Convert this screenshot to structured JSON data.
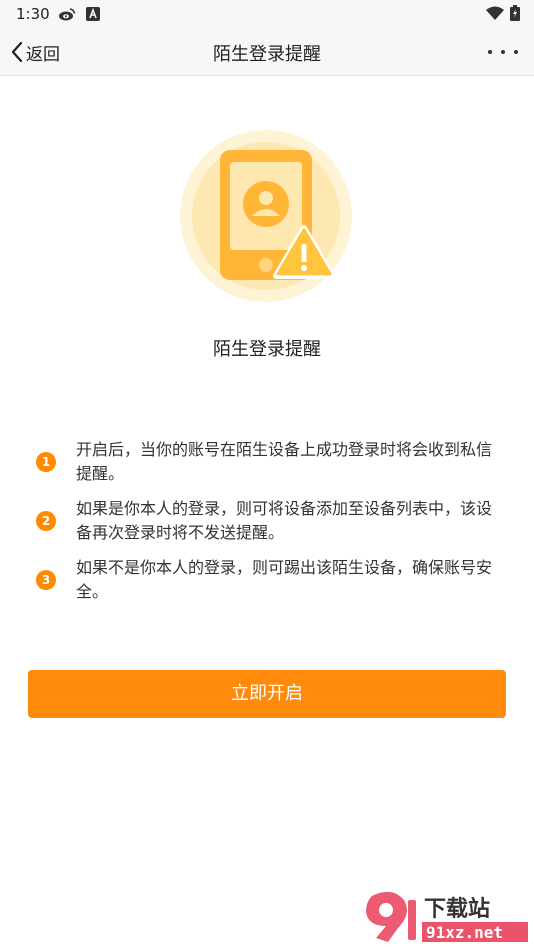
{
  "status_bar": {
    "time": "1:30",
    "icons": [
      "weibo-icon",
      "app-a-icon",
      "wifi-icon",
      "battery-charging-icon"
    ]
  },
  "nav": {
    "back_label": "返回",
    "title": "陌生登录提醒",
    "more_icon": "more-dots-icon"
  },
  "hero": {
    "icon": "phone-warning-icon",
    "caption": "陌生登录提醒"
  },
  "tips": [
    {
      "num": "1",
      "text": "开启后，当你的账号在陌生设备上成功登录时将会收到私信提醒。"
    },
    {
      "num": "2",
      "text": "如果是你本人的登录，则可将设备添加至设备列表中，该设备再次登录时将不发送提醒。"
    },
    {
      "num": "3",
      "text": "如果不是你本人的登录，则可踢出该陌生设备，确保账号安全。"
    }
  ],
  "primary_button": {
    "label": "立即开启"
  },
  "watermark": {
    "line1": "下载站",
    "line2": "91xz.net"
  },
  "colors": {
    "accent": "#ff8a0c",
    "nav_bg": "#f7f7f7",
    "hero_circle": "#fde8b3",
    "phone_body": "#ffb636"
  }
}
